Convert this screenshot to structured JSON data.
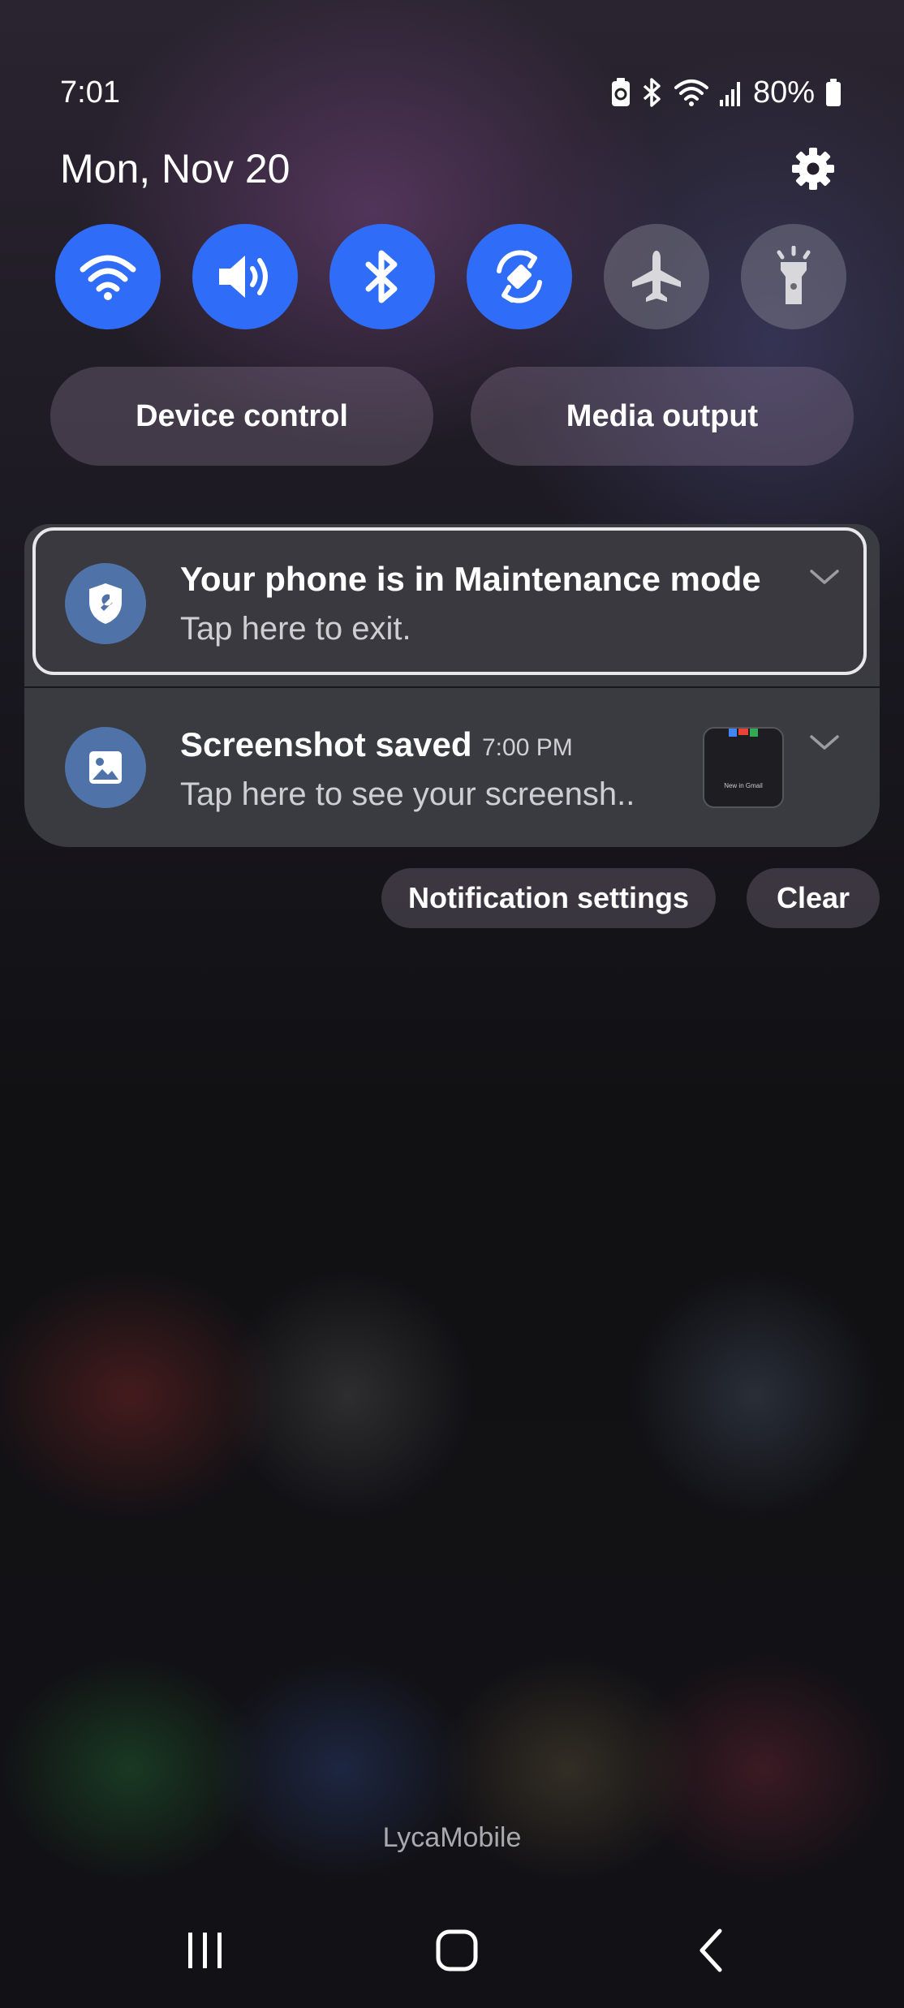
{
  "status_bar": {
    "time": "7:01",
    "battery_percent": "80%",
    "icons": [
      "battery-saver-icon",
      "bluetooth-icon",
      "wifi-icon",
      "signal-icon",
      "battery-icon"
    ]
  },
  "header": {
    "date": "Mon, Nov 20",
    "settings_icon": "gear-icon"
  },
  "quick_toggles": [
    {
      "name": "wifi",
      "icon": "wifi-icon",
      "state": "on"
    },
    {
      "name": "sound",
      "icon": "volume-icon",
      "state": "on"
    },
    {
      "name": "bluetooth",
      "icon": "bluetooth-icon",
      "state": "on"
    },
    {
      "name": "auto-rotate",
      "icon": "auto-rotate-icon",
      "state": "on"
    },
    {
      "name": "airplane-mode",
      "icon": "airplane-icon",
      "state": "off"
    },
    {
      "name": "flashlight",
      "icon": "flashlight-icon",
      "state": "off"
    }
  ],
  "pills": {
    "device_control": "Device control",
    "media_output": "Media output"
  },
  "notifications": [
    {
      "title": "Your phone is in Maintenance mode",
      "body": "Tap here to exit.",
      "icon": "maintenance-shield-icon"
    },
    {
      "title": "Screenshot saved",
      "time": "7:00 PM",
      "body": "Tap here to see your screensh..",
      "icon": "image-icon",
      "thumbnail_caption": "New in Gmail"
    }
  ],
  "actions": {
    "notification_settings": "Notification settings",
    "clear": "Clear"
  },
  "carrier": "LycaMobile",
  "colors": {
    "toggle_on": "#2f6cf7",
    "toggle_off": "#5f5e66",
    "notification_icon_bg": "#4f72a8"
  }
}
